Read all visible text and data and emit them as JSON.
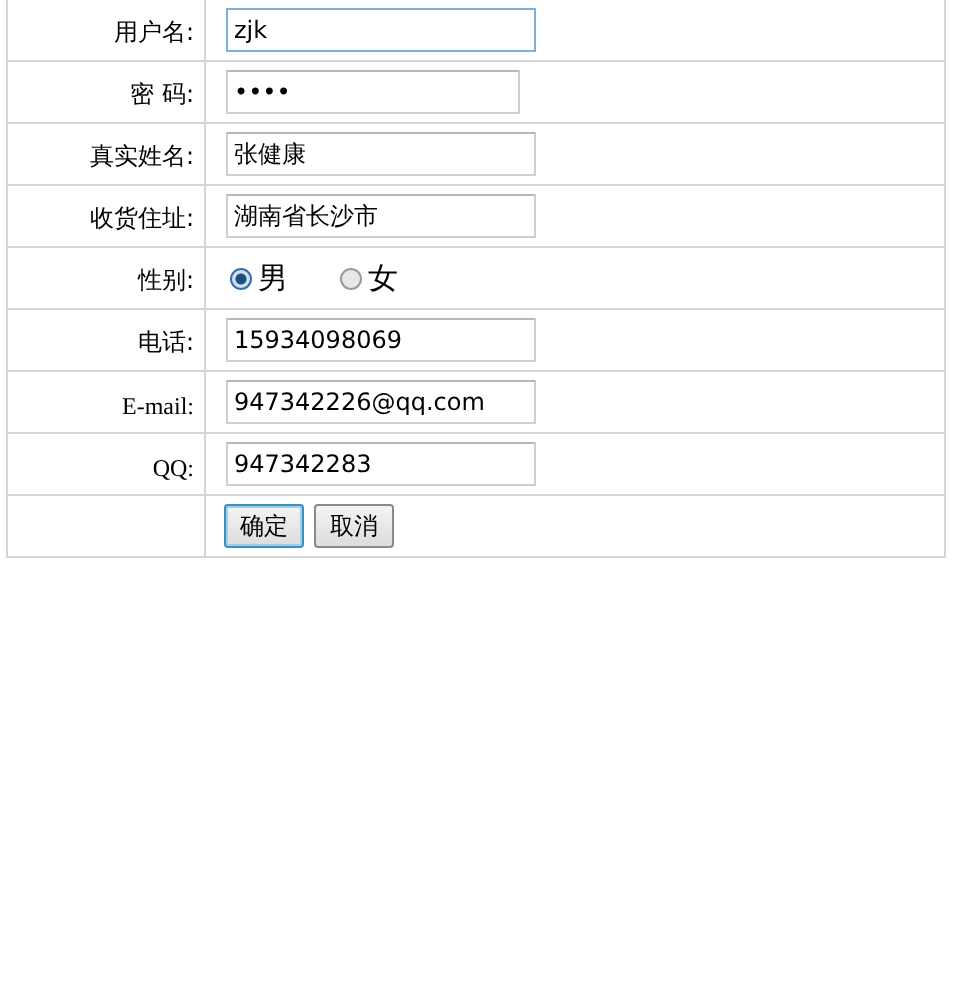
{
  "form": {
    "rows": [
      {
        "kind": "text",
        "label": "用户名:",
        "value": "zjk",
        "focused": true
      },
      {
        "kind": "text",
        "label": "密 码:",
        "value": "••••",
        "focused": false
      },
      {
        "kind": "text",
        "label": "真实姓名:",
        "value": "张健康",
        "focused": false
      },
      {
        "kind": "text",
        "label": "收货住址:",
        "value": "湖南省长沙市",
        "focused": false
      },
      {
        "kind": "radio",
        "label": "性别:",
        "options": [
          {
            "label": "男",
            "selected": true
          },
          {
            "label": "女",
            "selected": false
          }
        ]
      },
      {
        "kind": "text",
        "label": "电话:",
        "value": "15934098069",
        "focused": false
      },
      {
        "kind": "text",
        "label": "E-mail:",
        "value": "947342226@qq.com",
        "focused": false,
        "serif_label": true
      },
      {
        "kind": "text",
        "label": "QQ:",
        "value": "947342283",
        "focused": false,
        "serif_label": true
      },
      {
        "kind": "buttons",
        "buttons": [
          {
            "label": "确定",
            "focused": true
          },
          {
            "label": "取消",
            "focused": false
          }
        ]
      }
    ]
  }
}
